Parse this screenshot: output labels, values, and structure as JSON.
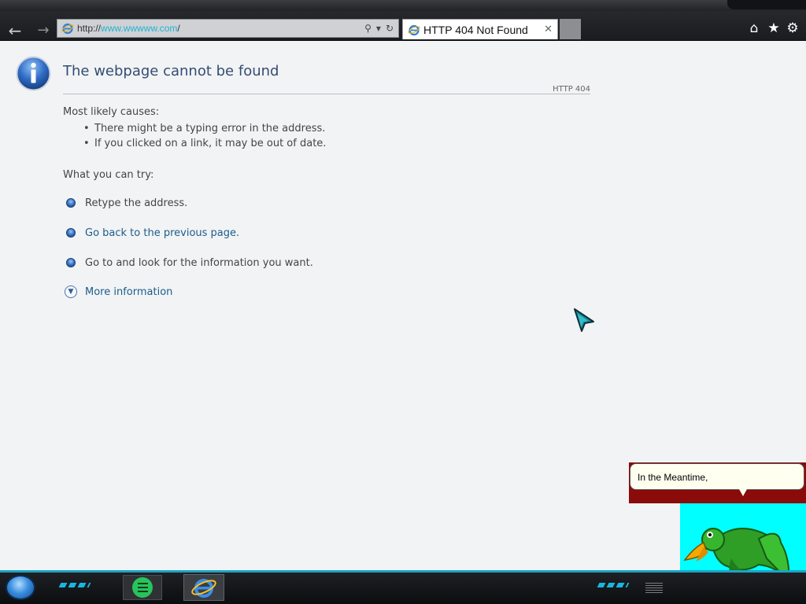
{
  "browser": {
    "address_scheme": "http://",
    "address_host": "www.wwwww.com",
    "address_path": "/",
    "tab_title": "HTTP 404 Not Found",
    "tab_close": "✕"
  },
  "page": {
    "title": "The webpage cannot be found",
    "code": "HTTP 404",
    "causes_heading": "Most likely causes:",
    "causes": [
      "There might be a typing error in the address.",
      "If you clicked on a link, it may be out of date."
    ],
    "try_heading": "What you can try:",
    "try_items": [
      "Retype the address.",
      "Go back to the previous page.",
      "Go to  and look for the information you want."
    ],
    "more_info": "More information"
  },
  "assistant": {
    "speech": "In the Meantime,"
  },
  "colors": {
    "accent": "#1ca3c7",
    "title": "#334d73",
    "link": "#1b5d8a",
    "assistant_bg": "#00ffff",
    "speech_frame": "#8b0a0a"
  },
  "icons": {
    "back": "back-arrow-icon",
    "forward": "forward-arrow-icon",
    "home": "home-icon",
    "favorites": "star-icon",
    "tools": "gear-icon",
    "info": "info-icon",
    "bullet": "blue-orb-icon",
    "expand": "expand-chevron-icon"
  }
}
